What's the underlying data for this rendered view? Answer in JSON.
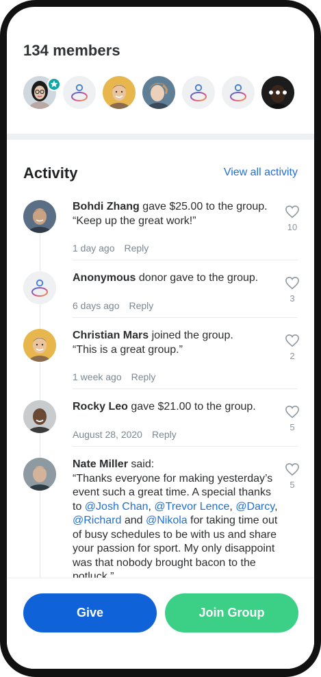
{
  "members": {
    "title": "134 members",
    "avatars": [
      {
        "kind": "photo",
        "tone": "#d9c0aa",
        "hair": "#1b1b1b",
        "bg": "#cfd8de",
        "badge": true
      },
      {
        "kind": "anonymous"
      },
      {
        "kind": "photo",
        "tone": "#e9c29c",
        "hair": "#6a4a2e",
        "bg": "#e7b64c"
      },
      {
        "kind": "photo",
        "tone": "#e9cdb6",
        "hair": "#c69a6a",
        "bg": "#5f7f96"
      },
      {
        "kind": "anonymous"
      },
      {
        "kind": "anonymous"
      },
      {
        "kind": "more",
        "tone": "#5a3d2b",
        "bg": "#2b2b2b"
      }
    ]
  },
  "activity": {
    "title": "Activity",
    "view_all": "View all activity",
    "items": [
      {
        "name": "Bohdi Zhang",
        "action": " gave $25.00 to the group.",
        "quote": "“Keep up the great work!”",
        "time": "1 day ago",
        "reply": "Reply",
        "likes": "10"
      },
      {
        "name": "Anonymous",
        "action": " donor gave to the group.",
        "time": "6 days ago",
        "reply": "Reply",
        "likes": "3"
      },
      {
        "name": "Christian Mars",
        "action": " joined the group.",
        "quote": "“This is a great group.”",
        "time": "1 week ago",
        "reply": "Reply",
        "likes": "2"
      },
      {
        "name": "Rocky Leo",
        "action": " gave $21.00 to the group.",
        "time": "August 28, 2020",
        "reply": "Reply",
        "likes": "5"
      },
      {
        "name": "Nate Miller",
        "action": " said:",
        "msg_a": "“Thanks everyone for making yesterday’s event such a great time. A special thanks to ",
        "mention_1": "@Josh Chan",
        "sep_1": ", ",
        "mention_2": "@Trevor Lence",
        "sep_2": ", ",
        "mention_3": "@Darcy",
        "sep_3": ", ",
        "mention_4": "@Richard",
        "sep_4": " and ",
        "mention_5": "@Nikola",
        "msg_b": " for taking time out of busy schedules to be with us and share your passion for sport. My only disappoint was that nobody brought bacon to the potluck.”",
        "likes": "5"
      }
    ]
  },
  "buttons": {
    "give": "Give",
    "join": "Join Group"
  },
  "colors": {
    "accent_blue": "#0f62d8",
    "accent_green": "#3ccf86",
    "link": "#1f6fd6",
    "badge_teal": "#0fa6a6"
  }
}
